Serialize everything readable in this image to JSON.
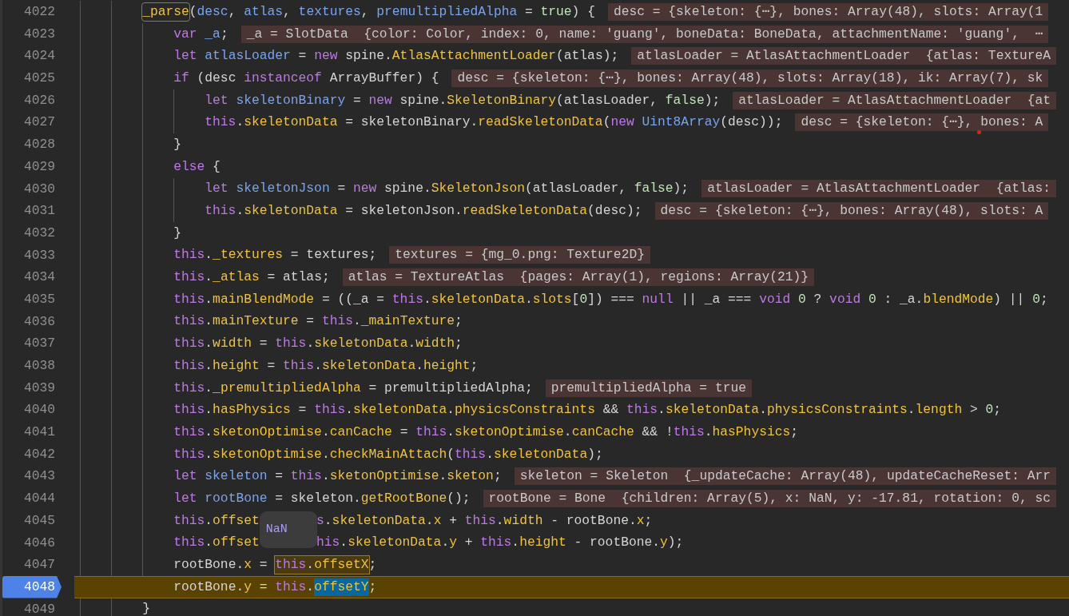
{
  "lines": [
    {
      "number": "4022",
      "current": false,
      "code": [
        {
          "kind": "match",
          "tokens": [
            {
              "kind": "prop",
              "text": "_parse"
            }
          ]
        },
        {
          "kind": "plain",
          "tokens": [
            {
              "kind": "txt",
              "text": "("
            },
            {
              "kind": "var",
              "text": "desc"
            },
            {
              "kind": "txt",
              "text": ", "
            },
            {
              "kind": "var",
              "text": "atlas"
            },
            {
              "kind": "txt",
              "text": ", "
            },
            {
              "kind": "var",
              "text": "textures"
            },
            {
              "kind": "txt",
              "text": ", "
            },
            {
              "kind": "var",
              "text": "premultipliedAlpha"
            },
            {
              "kind": "txt",
              "text": " = "
            },
            {
              "kind": "lit",
              "text": "true"
            },
            {
              "kind": "txt",
              "text": ") {"
            }
          ]
        }
      ],
      "value": "desc = {skeleton: {⋯}, bones: Array(48), slots: Array(1",
      "children": [
        {
          "number": "4023",
          "current": false,
          "code": [
            {
              "kind": "plain",
              "tokens": [
                {
                  "kind": "kw",
                  "text": "var "
                },
                {
                  "kind": "var",
                  "text": "_a"
                },
                {
                  "kind": "txt",
                  "text": ";"
                }
              ]
            }
          ],
          "value": "_a = SlotData  {color: Color, index: 0, name: 'guang', boneData: BoneData, attachmentName: 'guang',  ⋯"
        },
        {
          "number": "4024",
          "current": false,
          "code": [
            {
              "kind": "plain",
              "tokens": [
                {
                  "kind": "kw",
                  "text": "let "
                },
                {
                  "kind": "var",
                  "text": "atlasLoader"
                },
                {
                  "kind": "txt",
                  "text": " = "
                },
                {
                  "kind": "kw",
                  "text": "new"
                },
                {
                  "kind": "txt",
                  "text": " spine."
                },
                {
                  "kind": "prop",
                  "text": "AtlasAttachmentLoader"
                },
                {
                  "kind": "txt",
                  "text": "(atlas);"
                }
              ]
            }
          ],
          "value": "atlasLoader = AtlasAttachmentLoader  {atlas: TextureA"
        },
        {
          "number": "4025",
          "current": false,
          "code": [
            {
              "kind": "plain",
              "tokens": [
                {
                  "kind": "kw",
                  "text": "if"
                },
                {
                  "kind": "txt",
                  "text": " (desc "
                },
                {
                  "kind": "kw",
                  "text": "instanceof"
                },
                {
                  "kind": "txt",
                  "text": " ArrayBuffer) {"
                }
              ]
            }
          ],
          "value": "desc = {skeleton: {⋯}, bones: Array(48), slots: Array(18), ik: Array(7), sk",
          "children": [
            {
              "number": "4026",
              "current": false,
              "code": [
                {
                  "kind": "plain",
                  "tokens": [
                    {
                      "kind": "kw",
                      "text": "let "
                    },
                    {
                      "kind": "var",
                      "text": "skeletonBinary"
                    },
                    {
                      "kind": "txt",
                      "text": " = "
                    },
                    {
                      "kind": "kw",
                      "text": "new"
                    },
                    {
                      "kind": "txt",
                      "text": " spine."
                    },
                    {
                      "kind": "prop",
                      "text": "SkeletonBinary"
                    },
                    {
                      "kind": "txt",
                      "text": "(atlasLoader, "
                    },
                    {
                      "kind": "lit",
                      "text": "false"
                    },
                    {
                      "kind": "txt",
                      "text": ");"
                    }
                  ]
                }
              ],
              "value": "atlasLoader = AtlasAttachmentLoader  {at"
            },
            {
              "number": "4027",
              "current": false,
              "code": [
                {
                  "kind": "plain",
                  "tokens": [
                    {
                      "kind": "kw",
                      "text": "this"
                    },
                    {
                      "kind": "txt",
                      "text": "."
                    },
                    {
                      "kind": "prop",
                      "text": "skeletonData"
                    },
                    {
                      "kind": "txt",
                      "text": " = skeletonBinary."
                    },
                    {
                      "kind": "prop",
                      "text": "readSkeletonData"
                    },
                    {
                      "kind": "txt",
                      "text": "("
                    },
                    {
                      "kind": "kw",
                      "text": "new "
                    },
                    {
                      "kind": "var",
                      "text": "Uint8Array"
                    },
                    {
                      "kind": "txt",
                      "text": "(desc));"
                    }
                  ]
                }
              ],
              "value": "desc = {skeleton: {⋯}, bones: A",
              "dot": true
            }
          ]
        },
        {
          "number": "4028",
          "current": false,
          "code": [
            {
              "kind": "plain",
              "tokens": [
                {
                  "kind": "txt",
                  "text": "}"
                }
              ]
            }
          ]
        },
        {
          "number": "4029",
          "current": false,
          "code": [
            {
              "kind": "plain",
              "tokens": [
                {
                  "kind": "kw",
                  "text": "else"
                },
                {
                  "kind": "txt",
                  "text": " {"
                }
              ]
            }
          ],
          "children": [
            {
              "number": "4030",
              "current": false,
              "code": [
                {
                  "kind": "plain",
                  "tokens": [
                    {
                      "kind": "kw",
                      "text": "let "
                    },
                    {
                      "kind": "var",
                      "text": "skeletonJson"
                    },
                    {
                      "kind": "txt",
                      "text": " = "
                    },
                    {
                      "kind": "kw",
                      "text": "new"
                    },
                    {
                      "kind": "txt",
                      "text": " spine."
                    },
                    {
                      "kind": "prop",
                      "text": "SkeletonJson"
                    },
                    {
                      "kind": "txt",
                      "text": "(atlasLoader, "
                    },
                    {
                      "kind": "lit",
                      "text": "false"
                    },
                    {
                      "kind": "txt",
                      "text": ");"
                    }
                  ]
                }
              ],
              "value": "atlasLoader = AtlasAttachmentLoader  {atlas:"
            },
            {
              "number": "4031",
              "current": false,
              "code": [
                {
                  "kind": "plain",
                  "tokens": [
                    {
                      "kind": "kw",
                      "text": "this"
                    },
                    {
                      "kind": "txt",
                      "text": "."
                    },
                    {
                      "kind": "prop",
                      "text": "skeletonData"
                    },
                    {
                      "kind": "txt",
                      "text": " = skeletonJson."
                    },
                    {
                      "kind": "prop",
                      "text": "readSkeletonData"
                    },
                    {
                      "kind": "txt",
                      "text": "(desc);"
                    }
                  ]
                }
              ],
              "value": "desc = {skeleton: {⋯}, bones: Array(48), slots: A"
            }
          ]
        },
        {
          "number": "4032",
          "current": false,
          "code": [
            {
              "kind": "plain",
              "tokens": [
                {
                  "kind": "txt",
                  "text": "}"
                }
              ]
            }
          ]
        },
        {
          "number": "4033",
          "current": false,
          "code": [
            {
              "kind": "plain",
              "tokens": [
                {
                  "kind": "kw",
                  "text": "this"
                },
                {
                  "kind": "txt",
                  "text": "."
                },
                {
                  "kind": "prop",
                  "text": "_textures"
                },
                {
                  "kind": "txt",
                  "text": " = textures;"
                }
              ]
            }
          ],
          "value": "textures = {mg_0.png: Texture2D}"
        },
        {
          "number": "4034",
          "current": false,
          "code": [
            {
              "kind": "plain",
              "tokens": [
                {
                  "kind": "kw",
                  "text": "this"
                },
                {
                  "kind": "txt",
                  "text": "."
                },
                {
                  "kind": "prop",
                  "text": "_atlas"
                },
                {
                  "kind": "txt",
                  "text": " = atlas;"
                }
              ]
            }
          ],
          "value": "atlas = TextureAtlas  {pages: Array(1), regions: Array(21)}"
        },
        {
          "number": "4035",
          "current": false,
          "code": [
            {
              "kind": "plain",
              "tokens": [
                {
                  "kind": "kw",
                  "text": "this"
                },
                {
                  "kind": "txt",
                  "text": "."
                },
                {
                  "kind": "prop",
                  "text": "mainBlendMode"
                },
                {
                  "kind": "txt",
                  "text": " = ((_a = "
                },
                {
                  "kind": "kw",
                  "text": "this"
                },
                {
                  "kind": "txt",
                  "text": "."
                },
                {
                  "kind": "prop",
                  "text": "skeletonData"
                },
                {
                  "kind": "txt",
                  "text": "."
                },
                {
                  "kind": "prop",
                  "text": "slots"
                },
                {
                  "kind": "txt",
                  "text": "["
                },
                {
                  "kind": "lit",
                  "text": "0"
                },
                {
                  "kind": "txt",
                  "text": "]) === "
                },
                {
                  "kind": "kw",
                  "text": "null"
                },
                {
                  "kind": "txt",
                  "text": " || _a === "
                },
                {
                  "kind": "kw",
                  "text": "void "
                },
                {
                  "kind": "lit",
                  "text": "0"
                },
                {
                  "kind": "txt",
                  "text": " ? "
                },
                {
                  "kind": "kw",
                  "text": "void "
                },
                {
                  "kind": "lit",
                  "text": "0"
                },
                {
                  "kind": "txt",
                  "text": " : _a."
                },
                {
                  "kind": "prop",
                  "text": "blendMode"
                },
                {
                  "kind": "txt",
                  "text": ") || "
                },
                {
                  "kind": "lit",
                  "text": "0"
                },
                {
                  "kind": "txt",
                  "text": ";"
                }
              ]
            }
          ]
        },
        {
          "number": "4036",
          "current": false,
          "code": [
            {
              "kind": "plain",
              "tokens": [
                {
                  "kind": "kw",
                  "text": "this"
                },
                {
                  "kind": "txt",
                  "text": "."
                },
                {
                  "kind": "prop",
                  "text": "mainTexture"
                },
                {
                  "kind": "txt",
                  "text": " = "
                },
                {
                  "kind": "kw",
                  "text": "this"
                },
                {
                  "kind": "txt",
                  "text": "."
                },
                {
                  "kind": "prop",
                  "text": "_mainTexture"
                },
                {
                  "kind": "txt",
                  "text": ";"
                }
              ]
            }
          ]
        },
        {
          "number": "4037",
          "current": false,
          "code": [
            {
              "kind": "plain",
              "tokens": [
                {
                  "kind": "kw",
                  "text": "this"
                },
                {
                  "kind": "txt",
                  "text": "."
                },
                {
                  "kind": "prop",
                  "text": "width"
                },
                {
                  "kind": "txt",
                  "text": " = "
                },
                {
                  "kind": "kw",
                  "text": "this"
                },
                {
                  "kind": "txt",
                  "text": "."
                },
                {
                  "kind": "prop",
                  "text": "skeletonData"
                },
                {
                  "kind": "txt",
                  "text": "."
                },
                {
                  "kind": "prop",
                  "text": "width"
                },
                {
                  "kind": "txt",
                  "text": ";"
                }
              ]
            }
          ]
        },
        {
          "number": "4038",
          "current": false,
          "code": [
            {
              "kind": "plain",
              "tokens": [
                {
                  "kind": "kw",
                  "text": "this"
                },
                {
                  "kind": "txt",
                  "text": "."
                },
                {
                  "kind": "prop",
                  "text": "height"
                },
                {
                  "kind": "txt",
                  "text": " = "
                },
                {
                  "kind": "kw",
                  "text": "this"
                },
                {
                  "kind": "txt",
                  "text": "."
                },
                {
                  "kind": "prop",
                  "text": "skeletonData"
                },
                {
                  "kind": "txt",
                  "text": "."
                },
                {
                  "kind": "prop",
                  "text": "height"
                },
                {
                  "kind": "txt",
                  "text": ";"
                }
              ]
            }
          ]
        },
        {
          "number": "4039",
          "current": false,
          "code": [
            {
              "kind": "plain",
              "tokens": [
                {
                  "kind": "kw",
                  "text": "this"
                },
                {
                  "kind": "txt",
                  "text": "."
                },
                {
                  "kind": "prop",
                  "text": "_premultipliedAlpha"
                },
                {
                  "kind": "txt",
                  "text": " = premultipliedAlpha;"
                }
              ]
            }
          ],
          "value": "premultipliedAlpha = true"
        },
        {
          "number": "4040",
          "current": false,
          "code": [
            {
              "kind": "plain",
              "tokens": [
                {
                  "kind": "kw",
                  "text": "this"
                },
                {
                  "kind": "txt",
                  "text": "."
                },
                {
                  "kind": "prop",
                  "text": "hasPhysics"
                },
                {
                  "kind": "txt",
                  "text": " = "
                },
                {
                  "kind": "kw",
                  "text": "this"
                },
                {
                  "kind": "txt",
                  "text": "."
                },
                {
                  "kind": "prop",
                  "text": "skeletonData"
                },
                {
                  "kind": "txt",
                  "text": "."
                },
                {
                  "kind": "prop",
                  "text": "physicsConstraints"
                },
                {
                  "kind": "txt",
                  "text": " && "
                },
                {
                  "kind": "kw",
                  "text": "this"
                },
                {
                  "kind": "txt",
                  "text": "."
                },
                {
                  "kind": "prop",
                  "text": "skeletonData"
                },
                {
                  "kind": "txt",
                  "text": "."
                },
                {
                  "kind": "prop",
                  "text": "physicsConstraints"
                },
                {
                  "kind": "txt",
                  "text": "."
                },
                {
                  "kind": "prop",
                  "text": "length"
                },
                {
                  "kind": "txt",
                  "text": " > "
                },
                {
                  "kind": "lit",
                  "text": "0"
                },
                {
                  "kind": "txt",
                  "text": ";"
                }
              ]
            }
          ]
        },
        {
          "number": "4041",
          "current": false,
          "code": [
            {
              "kind": "plain",
              "tokens": [
                {
                  "kind": "kw",
                  "text": "this"
                },
                {
                  "kind": "txt",
                  "text": "."
                },
                {
                  "kind": "prop",
                  "text": "sketonOptimise"
                },
                {
                  "kind": "txt",
                  "text": "."
                },
                {
                  "kind": "prop",
                  "text": "canCache"
                },
                {
                  "kind": "txt",
                  "text": " = "
                },
                {
                  "kind": "kw",
                  "text": "this"
                },
                {
                  "kind": "txt",
                  "text": "."
                },
                {
                  "kind": "prop",
                  "text": "sketonOptimise"
                },
                {
                  "kind": "txt",
                  "text": "."
                },
                {
                  "kind": "prop",
                  "text": "canCache"
                },
                {
                  "kind": "txt",
                  "text": " && !"
                },
                {
                  "kind": "kw",
                  "text": "this"
                },
                {
                  "kind": "txt",
                  "text": "."
                },
                {
                  "kind": "prop",
                  "text": "hasPhysics"
                },
                {
                  "kind": "txt",
                  "text": ";"
                }
              ]
            }
          ]
        },
        {
          "number": "4042",
          "current": false,
          "code": [
            {
              "kind": "plain",
              "tokens": [
                {
                  "kind": "kw",
                  "text": "this"
                },
                {
                  "kind": "txt",
                  "text": "."
                },
                {
                  "kind": "prop",
                  "text": "sketonOptimise"
                },
                {
                  "kind": "txt",
                  "text": "."
                },
                {
                  "kind": "prop",
                  "text": "checkMainAttach"
                },
                {
                  "kind": "txt",
                  "text": "("
                },
                {
                  "kind": "kw",
                  "text": "this"
                },
                {
                  "kind": "txt",
                  "text": "."
                },
                {
                  "kind": "prop",
                  "text": "skeletonData"
                },
                {
                  "kind": "txt",
                  "text": ");"
                }
              ]
            }
          ]
        },
        {
          "number": "4043",
          "current": false,
          "code": [
            {
              "kind": "plain",
              "tokens": [
                {
                  "kind": "kw",
                  "text": "let "
                },
                {
                  "kind": "var",
                  "text": "skeleton"
                },
                {
                  "kind": "txt",
                  "text": " = "
                },
                {
                  "kind": "kw",
                  "text": "this"
                },
                {
                  "kind": "txt",
                  "text": "."
                },
                {
                  "kind": "prop",
                  "text": "sketonOptimise"
                },
                {
                  "kind": "txt",
                  "text": "."
                },
                {
                  "kind": "prop",
                  "text": "sketon"
                },
                {
                  "kind": "txt",
                  "text": ";"
                }
              ]
            }
          ],
          "value": "skeleton = Skeleton  {_updateCache: Array(48), updateCacheReset: Arr"
        },
        {
          "number": "4044",
          "current": false,
          "code": [
            {
              "kind": "plain",
              "tokens": [
                {
                  "kind": "kw",
                  "text": "let "
                },
                {
                  "kind": "var",
                  "text": "rootBone"
                },
                {
                  "kind": "txt",
                  "text": " = skeleton."
                },
                {
                  "kind": "prop",
                  "text": "getRootBone"
                },
                {
                  "kind": "txt",
                  "text": "();"
                }
              ]
            }
          ],
          "value": "rootBone = Bone  {children: Array(5), x: NaN, y: -17.81, rotation: 0, sc"
        },
        {
          "number": "4045",
          "current": false,
          "code": [
            {
              "kind": "plain",
              "tokens": [
                {
                  "kind": "kw",
                  "text": "this"
                },
                {
                  "kind": "txt",
                  "text": "."
                },
                {
                  "kind": "prop",
                  "text": "offset"
                }
              ]
            },
            {
              "kind": "gap"
            },
            {
              "kind": "plain",
              "tokens": [
                {
                  "kind": "kw",
                  "text": "s"
                },
                {
                  "kind": "txt",
                  "text": "."
                },
                {
                  "kind": "prop",
                  "text": "skeletonData"
                },
                {
                  "kind": "txt",
                  "text": "."
                },
                {
                  "kind": "prop",
                  "text": "x"
                },
                {
                  "kind": "txt",
                  "text": " + "
                },
                {
                  "kind": "kw",
                  "text": "this"
                },
                {
                  "kind": "txt",
                  "text": "."
                },
                {
                  "kind": "prop",
                  "text": "width"
                },
                {
                  "kind": "txt",
                  "text": " - rootBone."
                },
                {
                  "kind": "prop",
                  "text": "x"
                },
                {
                  "kind": "txt",
                  "text": ";"
                }
              ]
            }
          ],
          "tooltip": "NaN"
        },
        {
          "number": "4046",
          "current": false,
          "code": [
            {
              "kind": "plain",
              "tokens": [
                {
                  "kind": "kw",
                  "text": "this"
                },
                {
                  "kind": "txt",
                  "text": "."
                },
                {
                  "kind": "prop",
                  "text": "offset"
                }
              ]
            },
            {
              "kind": "gap"
            },
            {
              "kind": "plain",
              "tokens": [
                {
                  "kind": "kw",
                  "text": "his"
                },
                {
                  "kind": "txt",
                  "text": "."
                },
                {
                  "kind": "prop",
                  "text": "skeletonData"
                },
                {
                  "kind": "txt",
                  "text": "."
                },
                {
                  "kind": "prop",
                  "text": "y"
                },
                {
                  "kind": "txt",
                  "text": " + "
                },
                {
                  "kind": "kw",
                  "text": "this"
                },
                {
                  "kind": "txt",
                  "text": "."
                },
                {
                  "kind": "prop",
                  "text": "height"
                },
                {
                  "kind": "txt",
                  "text": " - rootBone."
                },
                {
                  "kind": "prop",
                  "text": "y"
                },
                {
                  "kind": "txt",
                  "text": ");"
                }
              ]
            }
          ]
        },
        {
          "number": "4047",
          "current": false,
          "code": [
            {
              "kind": "plain",
              "tokens": [
                {
                  "kind": "txt",
                  "text": "rootBone."
                },
                {
                  "kind": "prop",
                  "text": "x"
                },
                {
                  "kind": "txt",
                  "text": " = "
                }
              ]
            },
            {
              "kind": "hover",
              "tokens": [
                {
                  "kind": "kw",
                  "text": "this"
                },
                {
                  "kind": "txt",
                  "text": "."
                },
                {
                  "kind": "prop",
                  "text": "offsetX"
                }
              ]
            },
            {
              "kind": "plain",
              "tokens": [
                {
                  "kind": "txt",
                  "text": ";"
                }
              ]
            }
          ]
        },
        {
          "number": "4048",
          "current": true,
          "code": [
            {
              "kind": "plain",
              "tokens": [
                {
                  "kind": "txt",
                  "text": "rootBone."
                },
                {
                  "kind": "prop",
                  "text": "y"
                },
                {
                  "kind": "txt",
                  "text": " = "
                },
                {
                  "kind": "kw",
                  "text": "this"
                },
                {
                  "kind": "txt",
                  "text": "."
                }
              ]
            },
            {
              "kind": "selection",
              "tokens": [
                {
                  "kind": "prop",
                  "text": "offsetY"
                }
              ]
            },
            {
              "kind": "plain",
              "tokens": [
                {
                  "kind": "txt",
                  "text": ";"
                }
              ]
            }
          ]
        }
      ]
    },
    {
      "number": "4049",
      "current": false,
      "code": [
        {
          "kind": "plain",
          "tokens": [
            {
              "kind": "txt",
              "text": "}"
            }
          ]
        }
      ]
    }
  ]
}
